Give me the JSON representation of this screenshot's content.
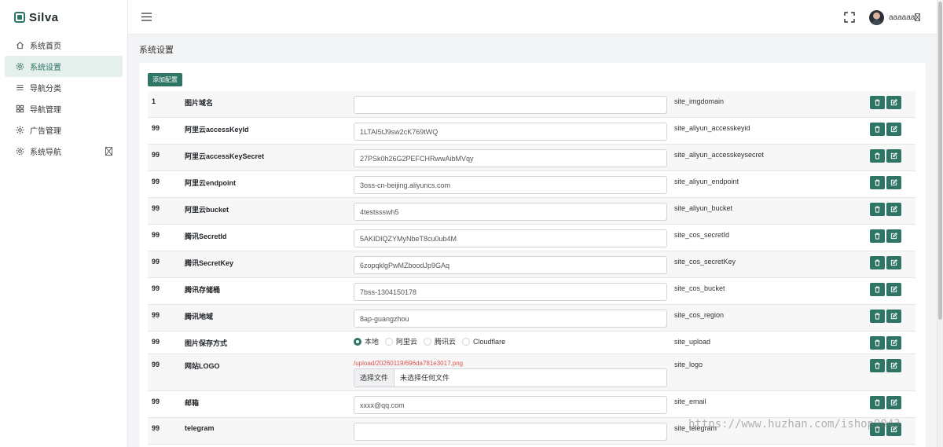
{
  "brand": {
    "name": "Silva"
  },
  "sidebar": {
    "items": [
      {
        "label": "系统首页",
        "icon": "home-icon"
      },
      {
        "label": "系统设置",
        "icon": "gear-icon",
        "active": true
      },
      {
        "label": "导航分类",
        "icon": "list-icon"
      },
      {
        "label": "导航管理",
        "icon": "grid-icon"
      },
      {
        "label": "广告管理",
        "icon": "sun-icon"
      },
      {
        "label": "系统导航",
        "icon": "gear-icon"
      }
    ]
  },
  "header": {
    "user_name": "aaaaaa"
  },
  "page": {
    "title": "系统设置",
    "add_button": "添加配置"
  },
  "config_rows": [
    {
      "num": "1",
      "label": "图片域名",
      "value": "",
      "key": "site_imgdomain"
    },
    {
      "num": "99",
      "label": "阿里云accessKeyId",
      "value": "1LTAI5tJ9sw2cK769tWQ",
      "key": "site_aliyun_accesskeyid"
    },
    {
      "num": "99",
      "label": "阿里云accessKeySecret",
      "value": "27PSk0h26G2PEFCHRwwAibMVqy",
      "key": "site_aliyun_accesskeysecret"
    },
    {
      "num": "99",
      "label": "阿里云endpoint",
      "value": "3oss-cn-beijing.aliyuncs.com",
      "key": "site_aliyun_endpoint"
    },
    {
      "num": "99",
      "label": "阿里云bucket",
      "value": "4testssswh5",
      "key": "site_aliyun_bucket"
    },
    {
      "num": "99",
      "label": "腾讯SecretId",
      "value": "5AKIDIQZYMyNbeT8cu0ub4M",
      "key": "site_cos_secretId"
    },
    {
      "num": "99",
      "label": "腾讯SecretKey",
      "value": "6zopqklgPwMZboodJp9GAq",
      "key": "site_cos_secretKey"
    },
    {
      "num": "99",
      "label": "腾讯存储桶",
      "value": "7bss-1304150178",
      "key": "site_cos_bucket"
    },
    {
      "num": "99",
      "label": "腾讯地域",
      "value": "8ap-guangzhou",
      "key": "site_cos_region"
    }
  ],
  "upload_row": {
    "num": "99",
    "label": "图片保存方式",
    "key": "site_upload",
    "options": [
      "本地",
      "阿里云",
      "腾讯云",
      "Cloudflare"
    ],
    "selected": "本地"
  },
  "logo_row": {
    "num": "99",
    "label": "网站LOGO",
    "key": "site_logo",
    "path": "/upload/20260119/696da781e3017.png",
    "file_button": "选择文件",
    "file_text": "未选择任何文件"
  },
  "email_row": {
    "num": "99",
    "label": "邮箱",
    "value": "xxxx@qq.com",
    "key": "site_email"
  },
  "telegram_row": {
    "num": "99",
    "label": "telegram",
    "value": "",
    "key": "site_telegram"
  },
  "colors": {
    "accent": "#2f7566",
    "path_red": "#d9534f"
  },
  "watermark": "https://www.huzhan.com/ishop9043"
}
